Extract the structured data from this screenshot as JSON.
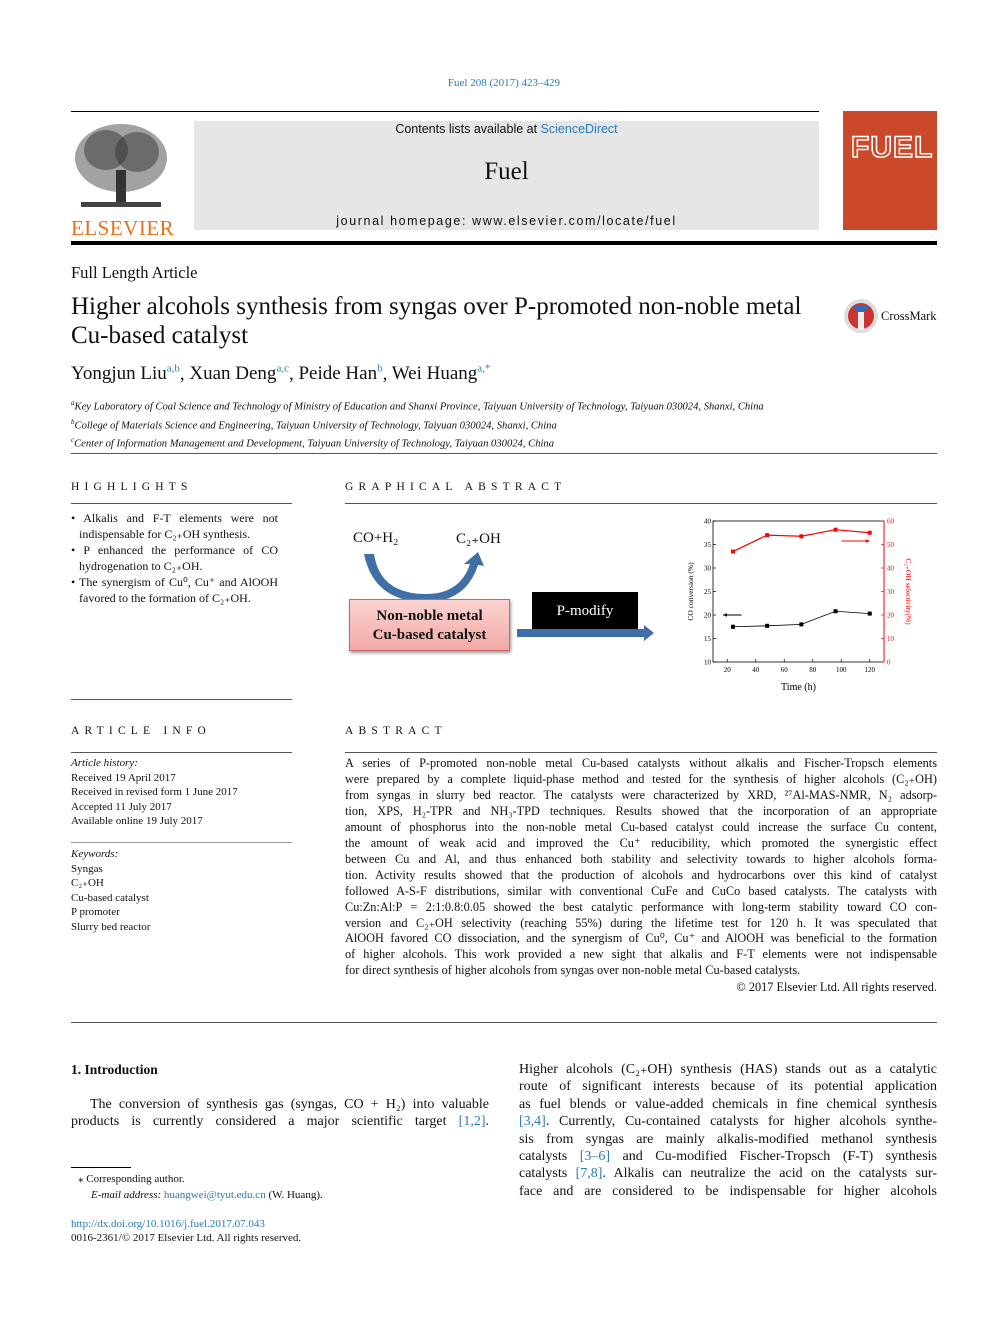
{
  "header": {
    "journal_ref": "Fuel 208 (2017) 423–429",
    "contents_prefix": "Contents lists available at ",
    "contents_link": "ScienceDirect",
    "journal_name": "Fuel",
    "homepage": "journal homepage: www.elsevier.com/locate/fuel",
    "publisher_logo": "ELSEVIER",
    "cover_title": "FUEL",
    "crossmark": "CrossMark"
  },
  "article": {
    "type": "Full Length Article",
    "title_lines": [
      "Higher alcohols synthesis from syngas over P-promoted non-noble metal",
      "Cu-based catalyst"
    ],
    "authors": [
      {
        "name": "Yongjun Liu",
        "sup": "a,b"
      },
      {
        "name": "Xuan Deng",
        "sup": "a,c"
      },
      {
        "name": "Peide Han",
        "sup": "b"
      },
      {
        "name": "Wei Huang",
        "sup": "a,*"
      }
    ],
    "affiliations": [
      {
        "mark": "a",
        "text": "Key Laboratory of Coal Science and Technology of Ministry of Education and Shanxi Province, Taiyuan University of Technology, Taiyuan 030024, Shanxi, China"
      },
      {
        "mark": "b",
        "text": "College of Materials Science and Engineering, Taiyuan University of Technology, Taiyuan 030024, Shanxi, China"
      },
      {
        "mark": "c",
        "text": "Center of Information Management and Development, Taiyuan University of Technology, Taiyuan 030024, China"
      }
    ]
  },
  "highlights": {
    "heading": "HIGHLIGHTS",
    "lines": [
      [
        "• Alkalis and F-T elements were not",
        "indispensable for C₂₊OH synthesis."
      ],
      [
        "• P enhanced the performance of CO",
        "hydrogenation to C₂₊OH."
      ],
      [
        "• The synergism of Cu⁰, Cu⁺ and AlOOH",
        "favored to the formation of C₂₊OH."
      ]
    ]
  },
  "graphical_abstract": {
    "heading": "GRAPHICAL ABSTRACT",
    "reactant": "CO+H₂",
    "product": "C₂₊OH",
    "catalyst_box": [
      "Non-noble metal",
      "Cu-based catalyst"
    ],
    "modify_box": "P-modify",
    "colors": {
      "arrow": "#3f6fa6",
      "catalyst_fill": "#f6b9b6",
      "modify_fill": "#000000",
      "series_co": "#000000",
      "series_sel": "#ff0000"
    }
  },
  "chart_data": {
    "type": "line",
    "xlabel": "Time (h)",
    "ylabel": "CO conversion (%)",
    "y2label": "C₂₊OH selectivity(%)",
    "xlim": [
      10,
      130
    ],
    "ylim": [
      10,
      40
    ],
    "y2lim": [
      0,
      60
    ],
    "xticks": [
      20,
      40,
      60,
      80,
      100,
      120
    ],
    "yticks": [
      10,
      15,
      20,
      25,
      30,
      35,
      40
    ],
    "y2ticks": [
      0,
      10,
      20,
      30,
      40,
      50,
      60
    ],
    "grid": false,
    "series": [
      {
        "axis": "left",
        "color": "#000000",
        "x": [
          24,
          48,
          72,
          96,
          120
        ],
        "y": [
          17.5,
          17.7,
          18.0,
          20.8,
          20.3
        ]
      },
      {
        "axis": "right",
        "color": "#ff0000",
        "x": [
          24,
          48,
          72,
          96,
          120
        ],
        "y": [
          47,
          54,
          53.5,
          56.3,
          55
        ]
      }
    ],
    "annotations": [
      {
        "type": "arrow-left",
        "axis": "left",
        "x": [
          17,
          30
        ],
        "y": 20,
        "color": "#000000"
      },
      {
        "type": "arrow-right",
        "axis": "right",
        "x": [
          100,
          120
        ],
        "y": 51.5,
        "color": "#ff0000"
      }
    ]
  },
  "article_info": {
    "heading": "ARTICLE INFO",
    "history_label": "Article history:",
    "history": [
      "Received 19 April 2017",
      "Received in revised form 1 June 2017",
      "Accepted 11 July 2017",
      "Available online 19 July 2017"
    ],
    "keywords_label": "Keywords:",
    "keywords": [
      "Syngas",
      "C₂₊OH",
      "Cu-based catalyst",
      "P promoter",
      "Slurry bed reactor"
    ]
  },
  "abstract": {
    "heading": "ABSTRACT",
    "lines": [
      "A series of P-promoted non-noble metal Cu-based catalysts without alkalis and Fischer-Tropsch elements",
      "were prepared by a complete liquid-phase method and tested for the synthesis of higher alcohols (C₂₊OH)",
      "from syngas in slurry bed reactor. The catalysts were characterized by XRD, ²⁷Al-MAS-NMR, N₂ adsorp-",
      "tion, XPS, H₂-TPR and NH₃-TPD techniques. Results showed that the incorporation of an appropriate",
      "amount of phosphorus into the non-noble metal Cu-based catalyst could increase the surface Cu content,",
      "the amount of weak acid and improved the Cu⁺ reducibility, which promoted the synergistic effect",
      "between Cu and Al, and thus enhanced both stability and selectivity towards to higher alcohols forma-",
      "tion. Activity results showed that the production of alcohols and hydrocarbons over this kind of catalyst",
      "followed A-S-F distributions, similar with conventional CuFe and CuCo based catalysts. The catalysts with",
      "Cu:Zn:Al:P = 2:1:0.8:0.05 showed the best catalytic performance with long-term stability toward CO con-",
      "version and C₂₊OH selectivity (reaching 55%) during the lifetime test for 120 h. It was speculated that",
      "AlOOH favored CO dissociation, and the synergism of Cu⁰, Cu⁺ and AlOOH was beneficial to the formation",
      "of higher alcohols. This work provided a new sight that alkalis and F-T elements were not indispensable",
      "for direct synthesis of higher alcohols from syngas over non-noble metal Cu-based catalysts."
    ],
    "copyright": "© 2017 Elsevier Ltd. All rights reserved."
  },
  "introduction": {
    "heading": "1. Introduction",
    "left_lines": [
      [
        "The conversion of synthesis gas (syngas, CO + H₂) into valuable",
        ""
      ],
      [
        "products is currently considered a major scientific target ",
        "[1,2]"
      ]
    ],
    "right_lines": [
      [
        "Higher alcohols (C₂₊OH) synthesis (HAS) stands out as a catalytic"
      ],
      [
        "route of significant interests because of its potential application"
      ],
      [
        "as fuel blends or value-added chemicals in fine chemical synthesis"
      ],
      [
        "",
        "[3,4]",
        ". Currently, Cu-contained catalysts for higher alcohols synthe-"
      ],
      [
        "sis from syngas are mainly alkalis-modified methanol synthesis"
      ],
      [
        "catalysts ",
        "[3–6]",
        " and Cu-modified Fischer-Tropsch (F-T) synthesis"
      ],
      [
        "catalysts ",
        "[7,8]",
        ". Alkalis can neutralize the acid on the catalysts sur-"
      ],
      [
        "face and are considered to be indispensable for higher alcohols"
      ]
    ]
  },
  "footnote": {
    "corresponding": "⁎ Corresponding author.",
    "email_label": "E-mail address: ",
    "email": "huangwei@tyut.edu.cn",
    "email_suffix": " (W. Huang).",
    "doi": "http://dx.doi.org/10.1016/j.fuel.2017.07.043",
    "issn": "0016-2361/© 2017 Elsevier Ltd. All rights reserved."
  }
}
